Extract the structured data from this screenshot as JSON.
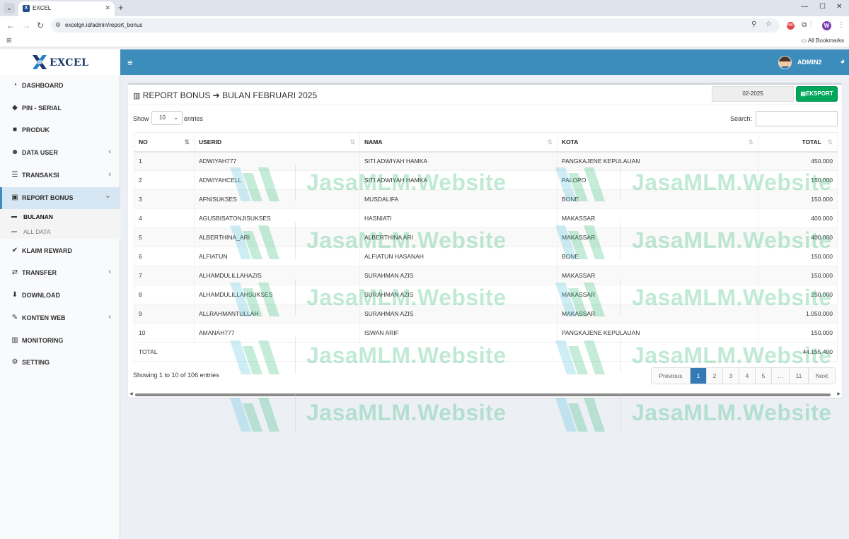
{
  "browser": {
    "tab_title": "EXCEL",
    "url": "excelgn.id/admin/report_bonus",
    "bookmarks_label": "All Bookmarks",
    "ext_abp": "ABP",
    "profile_initial": "W"
  },
  "logo": {
    "mark": "X",
    "text": "EXCEL"
  },
  "sidebar": {
    "items": [
      {
        "label": "DASHBOARD",
        "icon": "tachometer-icon"
      },
      {
        "label": "PIN - SERIAL",
        "icon": "tag-icon"
      },
      {
        "label": "PRODUK",
        "icon": "cube-icon"
      },
      {
        "label": "DATA USER",
        "icon": "users-icon",
        "chevron": "‹"
      },
      {
        "label": "TRANSAKSI",
        "icon": "list-icon",
        "chevron": "‹"
      },
      {
        "label": "REPORT BONUS",
        "icon": "money-icon",
        "chevron": "⌄"
      },
      {
        "label": "KLAIM REWARD",
        "icon": "check-icon"
      },
      {
        "label": "TRANSFER",
        "icon": "exchange-icon",
        "chevron": "‹"
      },
      {
        "label": "DOWNLOAD",
        "icon": "download-icon"
      },
      {
        "label": "KONTEN WEB",
        "icon": "edit-icon",
        "chevron": "‹"
      },
      {
        "label": "MONITORING",
        "icon": "bar-chart-icon"
      },
      {
        "label": "SETTING",
        "icon": "cogs-icon"
      }
    ],
    "submenu": [
      {
        "label": "BULANAN"
      },
      {
        "label": "ALL DATA"
      }
    ]
  },
  "header": {
    "user_name": "ADMIN2"
  },
  "report": {
    "title_left": "REPORT BONUS",
    "title_right": "BULAN FEBRUARI 2025",
    "month_value": "02-2025",
    "export_label": "EKSPORT",
    "show_label": "Show",
    "entries_label": "entries",
    "length_value": "10",
    "search_label": "Search:",
    "search_value": "",
    "columns": [
      "NO",
      "USERID",
      "NAMA",
      "KOTA",
      "TOTAL"
    ],
    "rows": [
      {
        "no": "1",
        "userid": "ADWIYAH777",
        "nama": "SITI ADWIYAH HAMKA",
        "kota": "PANGKAJENE KEPULAUAN",
        "total": "450.000"
      },
      {
        "no": "2",
        "userid": "ADWIYAHCELL",
        "nama": "SITI ADWIYAH HAMKA",
        "kota": "PALOPO",
        "total": "150.000"
      },
      {
        "no": "3",
        "userid": "AFNISUKSES",
        "nama": "MUSDALIFA",
        "kota": "BONE",
        "total": "150.000"
      },
      {
        "no": "4",
        "userid": "AGUSBISATONJISUKSES",
        "nama": "HASNIATI",
        "kota": "MAKASSAR",
        "total": "400.000"
      },
      {
        "no": "5",
        "userid": "ALBERTHINA_ARI",
        "nama": "ALBERTHINA ARI",
        "kota": "MAKASSAR",
        "total": "400.000"
      },
      {
        "no": "6",
        "userid": "ALFIATUN",
        "nama": "ALFIATUN HASANAH",
        "kota": "BONE",
        "total": "150.000"
      },
      {
        "no": "7",
        "userid": "ALHAMDULILLAHAZIS",
        "nama": "SURAHMAN AZIS",
        "kota": "MAKASSAR",
        "total": "150.000"
      },
      {
        "no": "8",
        "userid": "ALHAMDULILLAHSUKSES",
        "nama": "SURAHMAN AZIS",
        "kota": "MAKASSAR",
        "total": "250.000"
      },
      {
        "no": "9",
        "userid": "ALLRAHMANTULLAH",
        "nama": "SURAHMAN AZIS",
        "kota": "MAKASSAR",
        "total": "1.050.000"
      },
      {
        "no": "10",
        "userid": "AMANAH777",
        "nama": "ISWAN ARIF",
        "kota": "PANGKAJENE KEPULAUAN",
        "total": "150.000"
      }
    ],
    "footer_label": "TOTAL",
    "footer_total": "44.155.400",
    "info": "Showing 1 to 10 of 106 entries",
    "pagination": [
      "Previous",
      "1",
      "2",
      "3",
      "4",
      "5",
      "…",
      "11",
      "Next"
    ],
    "current_page": "1"
  },
  "watermark": {
    "text": "JasaMLM.Website"
  },
  "colors": {
    "header": "#3c8dbc",
    "export": "#00a65a",
    "active_page": "#337ab7",
    "watermark": "#2eb876"
  }
}
